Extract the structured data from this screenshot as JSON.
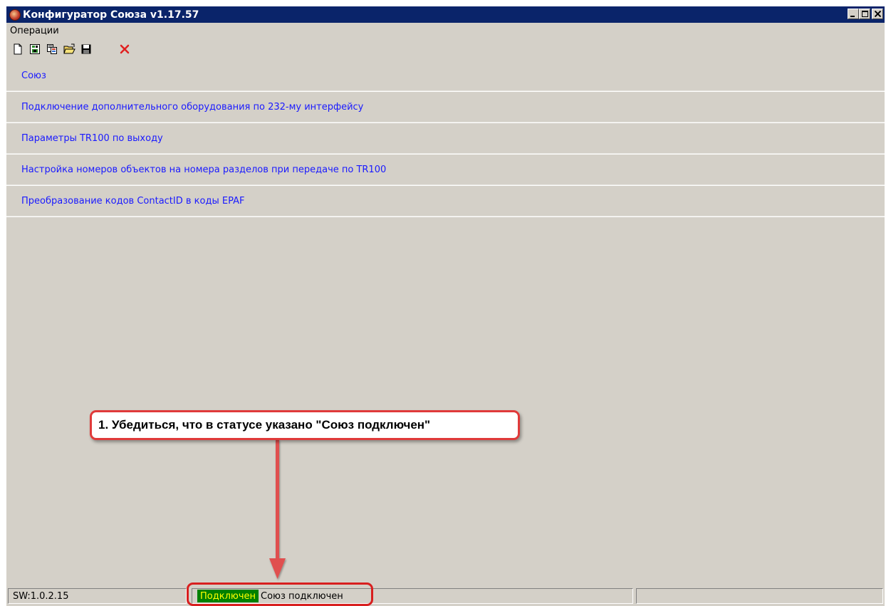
{
  "window": {
    "title": "Конфигуратор Союза v1.17.57",
    "controls": {
      "minimize": "_",
      "maximize": "□",
      "close": "×"
    }
  },
  "menu": {
    "items": [
      "Операции"
    ]
  },
  "toolbar": {
    "icons": [
      "new-document-icon",
      "device-icon",
      "copy-icon",
      "open-folder-icon",
      "save-icon",
      "delete-icon"
    ]
  },
  "sections": [
    "Союз",
    "Подключение дополнительного оборудования по 232-му интерфейсу",
    "Параметры TR100 по выходу",
    "Настройка номеров объектов на номера разделов при передаче по TR100",
    "Преобразование кодов ContactID в коды EPAF"
  ],
  "annotation": {
    "callout_text": "1. Убедиться, что в статусе указано \"Союз подключен\"",
    "color": "#e03a3a"
  },
  "statusbar": {
    "sw_version": "SW:1.0.2.15",
    "connection_state": "Подключен",
    "device_status": "Союз подключен",
    "connection_color": "#008000",
    "connection_text_color": "#ffff00"
  },
  "colors": {
    "titlebar": "#0a246a",
    "face": "#d4d0c8",
    "link": "#1a1aff"
  }
}
